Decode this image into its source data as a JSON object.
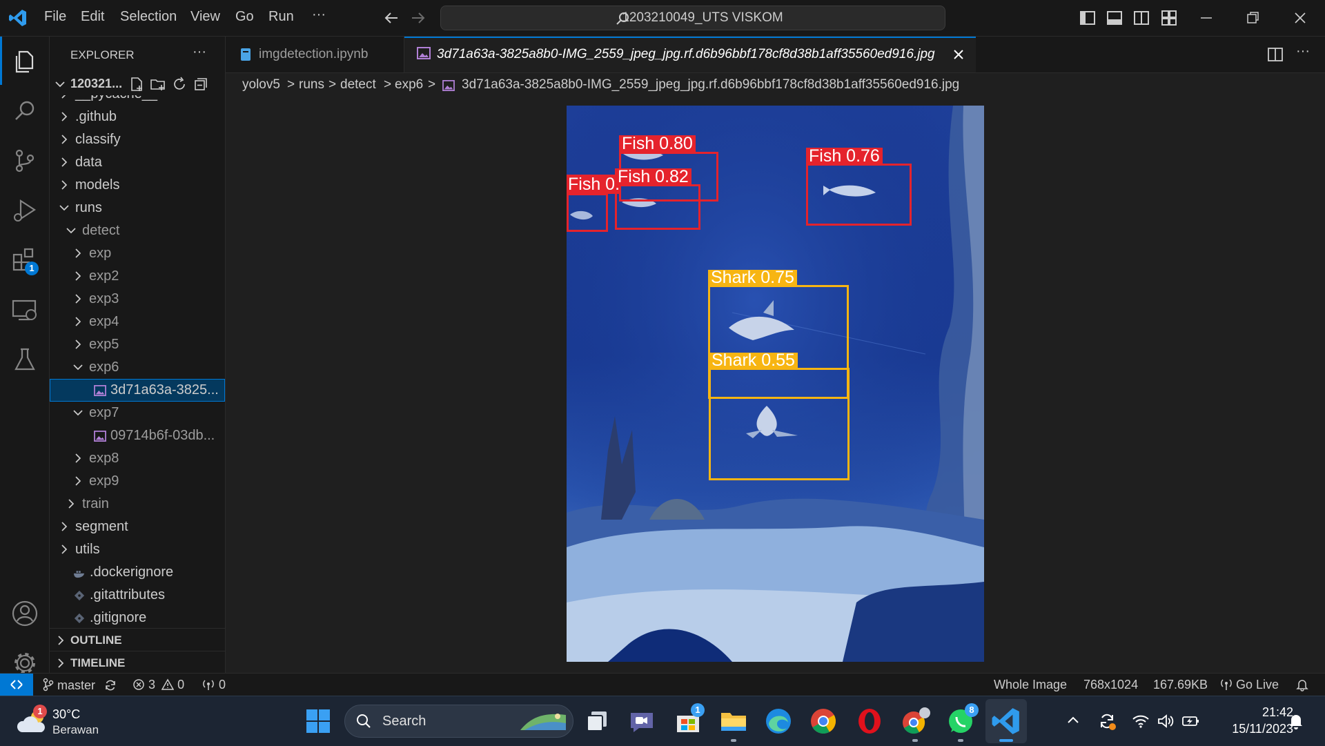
{
  "titlebar": {
    "menu": [
      "File",
      "Edit",
      "Selection",
      "View",
      "Go",
      "Run",
      "···"
    ],
    "search_text": "1203210049_UTS VISKOM"
  },
  "activity": {
    "extensions_badge": "1"
  },
  "sidebar": {
    "header": "EXPLORER",
    "header_more": "···",
    "root": "120321...",
    "items": [
      {
        "label": "__pycache__",
        "kind": "folder",
        "depth": 1,
        "open": false
      },
      {
        "label": ".github",
        "kind": "folder",
        "depth": 1,
        "open": false
      },
      {
        "label": "classify",
        "kind": "folder",
        "depth": 1,
        "open": false
      },
      {
        "label": "data",
        "kind": "folder",
        "depth": 1,
        "open": false
      },
      {
        "label": "models",
        "kind": "folder",
        "depth": 1,
        "open": false
      },
      {
        "label": "runs",
        "kind": "folder",
        "depth": 1,
        "open": true
      },
      {
        "label": "detect",
        "kind": "folder",
        "depth": 2,
        "open": true,
        "dim": true
      },
      {
        "label": "exp",
        "kind": "folder",
        "depth": 3,
        "open": false,
        "dim": true
      },
      {
        "label": "exp2",
        "kind": "folder",
        "depth": 3,
        "open": false,
        "dim": true
      },
      {
        "label": "exp3",
        "kind": "folder",
        "depth": 3,
        "open": false,
        "dim": true
      },
      {
        "label": "exp4",
        "kind": "folder",
        "depth": 3,
        "open": false,
        "dim": true
      },
      {
        "label": "exp5",
        "kind": "folder",
        "depth": 3,
        "open": false,
        "dim": true
      },
      {
        "label": "exp6",
        "kind": "folder",
        "depth": 3,
        "open": true,
        "dim": true
      },
      {
        "label": "3d71a63a-3825...",
        "kind": "image",
        "depth": 4,
        "selected": true
      },
      {
        "label": "exp7",
        "kind": "folder",
        "depth": 3,
        "open": true,
        "dim": true
      },
      {
        "label": "09714b6f-03db...",
        "kind": "image",
        "depth": 4,
        "dim": true
      },
      {
        "label": "exp8",
        "kind": "folder",
        "depth": 3,
        "open": false,
        "dim": true
      },
      {
        "label": "exp9",
        "kind": "folder",
        "depth": 3,
        "open": false,
        "dim": true
      },
      {
        "label": "train",
        "kind": "folder",
        "depth": 2,
        "open": false,
        "dim": true
      },
      {
        "label": "segment",
        "kind": "folder",
        "depth": 1,
        "open": false
      },
      {
        "label": "utils",
        "kind": "folder",
        "depth": 1,
        "open": false
      },
      {
        "label": ".dockerignore",
        "kind": "docker",
        "depth": 1
      },
      {
        "label": ".gitattributes",
        "kind": "git",
        "depth": 1
      },
      {
        "label": ".gitignore",
        "kind": "git",
        "depth": 1
      }
    ],
    "outline": "OUTLINE",
    "timeline": "TIMELINE"
  },
  "tabs": [
    {
      "label": "imgdetection.ipynb",
      "active": false
    },
    {
      "label": "3d71a63a-3825a8b0-IMG_2559_jpeg_jpg.rf.d6b96bbf178cf8d38b1aff35560ed916.jpg",
      "active": true
    }
  ],
  "breadcrumb": [
    "yolov5",
    "runs",
    "detect",
    "exp6",
    "3d71a63a-3825a8b0-IMG_2559_jpeg_jpg.rf.d6b96bbf178cf8d38b1aff35560ed916.jpg"
  ],
  "detections": [
    {
      "label": "Fish 0.80",
      "color": "#e5232c"
    },
    {
      "label": "Fish 0.82",
      "color": "#e5232c"
    },
    {
      "label": "Fish 0.51",
      "color": "#e5232c"
    },
    {
      "label": "Fish 0.76",
      "color": "#e5232c"
    },
    {
      "label": "Shark 0.75",
      "color": "#f7b512"
    },
    {
      "label": "Shark 0.55",
      "color": "#f7b512"
    }
  ],
  "statusbar": {
    "branch": "master",
    "errors": "3",
    "warnings": "0",
    "ports": "0",
    "zoom_mode": "Whole Image",
    "dimensions": "768x1024",
    "file_size": "167.69KB",
    "go_live": "Go Live"
  },
  "taskbar": {
    "weather_temp": "30°C",
    "weather_desc": "Berawan",
    "weather_badge": "1",
    "search_label": "Search",
    "store_badge": "1",
    "whatsapp_badge": "8",
    "time": "21:42",
    "date": "15/11/2023"
  },
  "colors": {
    "accent": "#0078d4",
    "selection": "#04395e",
    "fish_box": "#e5232c",
    "shark_box": "#f7b512"
  }
}
